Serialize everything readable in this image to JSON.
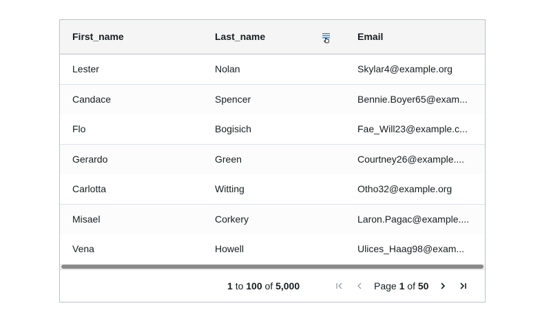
{
  "columns": {
    "first": "First_name",
    "last": "Last_name",
    "email": "Email"
  },
  "rows": [
    {
      "first": "Lester",
      "last": "Nolan",
      "email": "Skylar4@example.org"
    },
    {
      "first": "Candace",
      "last": "Spencer",
      "email": "Bennie.Boyer65@exam..."
    },
    {
      "first": "Flo",
      "last": "Bogisich",
      "email": "Fae_Will23@example.c..."
    },
    {
      "first": "Gerardo",
      "last": "Green",
      "email": "Courtney26@example...."
    },
    {
      "first": "Carlotta",
      "last": "Witting",
      "email": "Otho32@example.org"
    },
    {
      "first": "Misael",
      "last": "Corkery",
      "email": "Laron.Pagac@example...."
    },
    {
      "first": "Vena",
      "last": "Howell",
      "email": "Ulices_Haag98@exam..."
    }
  ],
  "paging": {
    "from": "1",
    "to_word": "to",
    "to": "100",
    "of_word": "of",
    "total": "5,000",
    "page_word": "Page",
    "current_page": "1",
    "page_of_word": "of",
    "total_pages": "50"
  },
  "icons": {
    "column_menu": "menu-icon",
    "first_page": "first-page-icon",
    "previous_page": "previous-page-icon",
    "next_page": "next-page-icon",
    "last_page": "last-page-icon"
  },
  "colors": {
    "header_bg": "#f5f5f5",
    "border": "#babfc7",
    "row_border": "#dde2eb",
    "menu_icon_accent": "#2196f3",
    "scroll_thumb": "#8a8a8a"
  }
}
